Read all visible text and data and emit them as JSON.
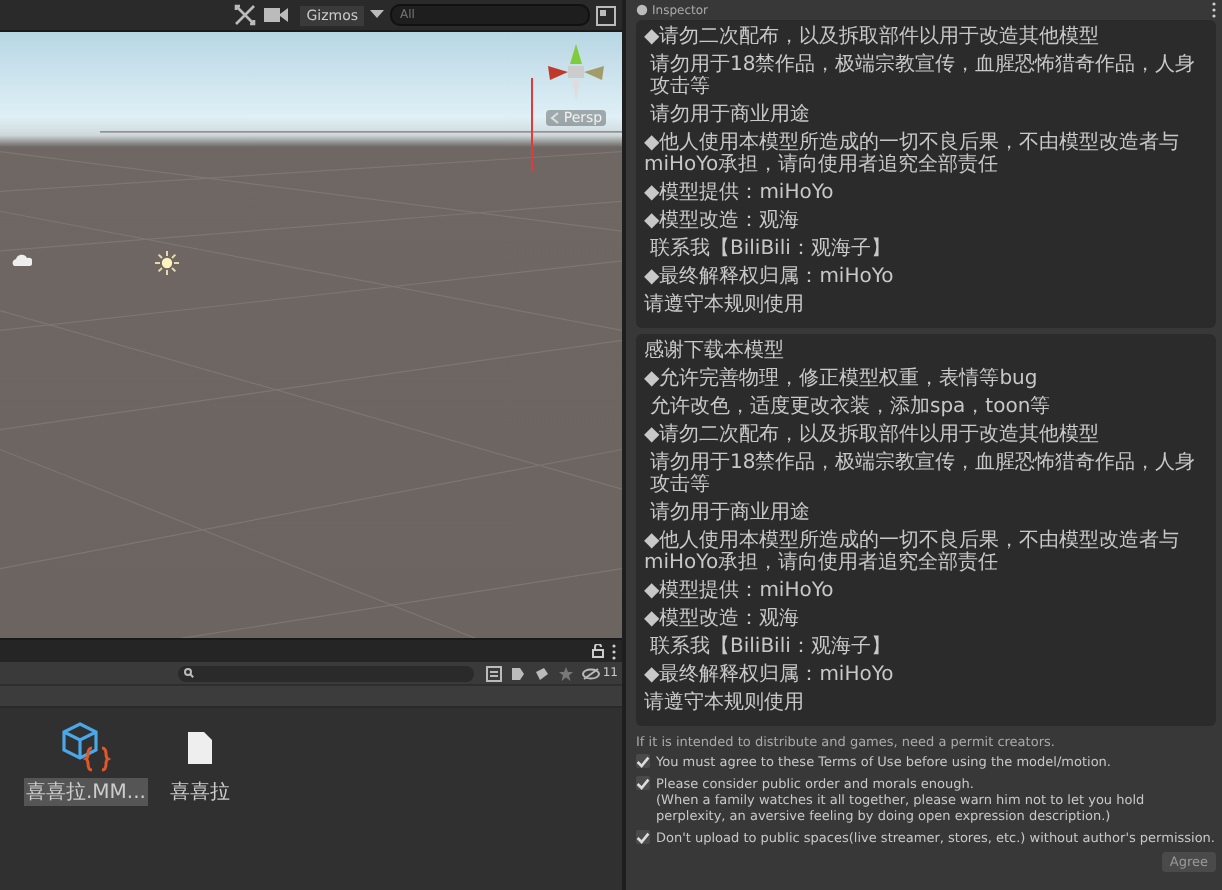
{
  "scene_toolbar": {
    "gizmos_label": "Gizmos",
    "search_placeholder": "All"
  },
  "scene_view": {
    "orientation_label": "Persp"
  },
  "project_panel": {
    "hidden_count": "11",
    "assets": [
      {
        "kind": "script",
        "label": "喜喜拉.MM...",
        "selected": true
      },
      {
        "kind": "file",
        "label": "喜喜拉",
        "selected": false
      }
    ]
  },
  "inspector": {
    "title": "Inspector",
    "sections": [
      {
        "lines": [
          {
            "kind": "plain",
            "text": "◆请勿二次配布，以及拆取部件以用于改造其他模型"
          },
          {
            "kind": "indented",
            "text": "请勿用于18禁作品，极端宗教宣传，血腥恐怖猎奇作品，人身攻击等"
          },
          {
            "kind": "indented",
            "text": "请勿用于商业用途"
          },
          {
            "kind": "plain",
            "text": "◆他人使用本模型所造成的一切不良后果，不由模型改造者与miHoYo承担，请向使用者追究全部责任"
          },
          {
            "kind": "plain",
            "text": "◆模型提供：miHoYo"
          },
          {
            "kind": "plain",
            "text": "◆模型改造：观海"
          },
          {
            "kind": "indented",
            "text": "联系我【BiliBili：观海子】"
          },
          {
            "kind": "plain",
            "text": "◆最终解释权归属：miHoYo"
          },
          {
            "kind": "plain",
            "text": "请遵守本规则使用"
          }
        ]
      },
      {
        "lines": [
          {
            "kind": "plain",
            "text": "感谢下载本模型"
          },
          {
            "kind": "plain",
            "text": "◆允许完善物理，修正模型权重，表情等bug"
          },
          {
            "kind": "indented",
            "text": "允许改色，适度更改衣装，添加spa，toon等"
          },
          {
            "kind": "plain",
            "text": "◆请勿二次配布，以及拆取部件以用于改造其他模型"
          },
          {
            "kind": "indented",
            "text": "请勿用于18禁作品，极端宗教宣传，血腥恐怖猎奇作品，人身攻击等"
          },
          {
            "kind": "indented",
            "text": "请勿用于商业用途"
          },
          {
            "kind": "plain",
            "text": "◆他人使用本模型所造成的一切不良后果，不由模型改造者与miHoYo承担，请向使用者追究全部责任"
          },
          {
            "kind": "plain",
            "text": "◆模型提供：miHoYo"
          },
          {
            "kind": "plain",
            "text": "◆模型改造：观海"
          },
          {
            "kind": "indented",
            "text": "联系我【BiliBili：观海子】"
          },
          {
            "kind": "plain",
            "text": "◆最终解释权归属：miHoYo"
          },
          {
            "kind": "plain",
            "text": "请遵守本规则使用"
          }
        ]
      }
    ],
    "notice": "If it is intended to distribute and games, need a permit creators.",
    "terms": [
      {
        "text": "You must agree to these Terms of Use before using the model/motion.",
        "checked": true
      },
      {
        "text": "Please consider public order and morals enough.\n(When a family watches it all together, please warn him not to let you hold perplexity, an aversive feeling by doing open expression description.)",
        "checked": true
      },
      {
        "text": "Don't upload to public spaces(live streamer, stores, etc.) without author's permission.",
        "checked": true
      }
    ],
    "agree_button": {
      "label": "Agree",
      "disabled": true
    }
  }
}
